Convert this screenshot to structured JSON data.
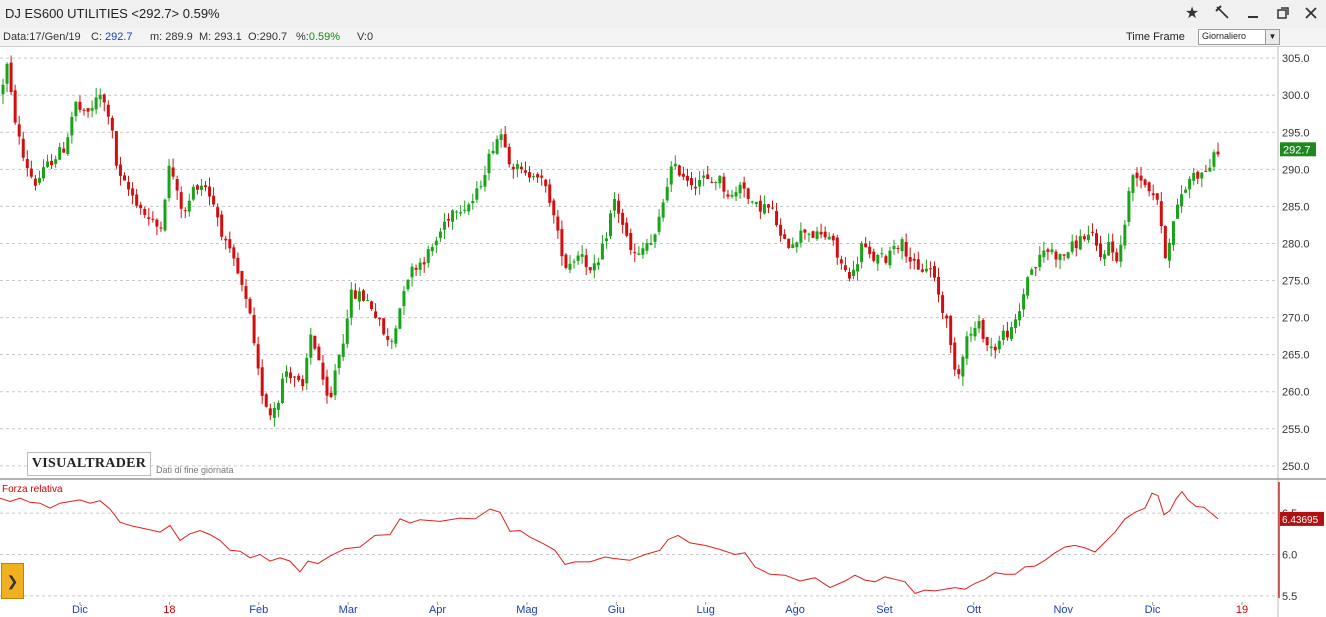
{
  "window": {
    "title": "DJ ES600 UTILITIES <292.7> 0.59%",
    "icons": [
      "star-icon",
      "pin-icon",
      "minimize-icon",
      "restore-icon",
      "close-icon"
    ]
  },
  "info_bar": {
    "date_label": "Data:",
    "date_value": "17/Gen/19",
    "close_label": "C:",
    "close_value": "292.7",
    "min_label": "m:",
    "min_value": "289.9",
    "max_label": "M:",
    "max_value": "293.1",
    "open_label": "O:",
    "open_value": "290.7",
    "pct_label": "%:",
    "pct_value": "0.59%",
    "vol_label": "V:",
    "vol_value": "0"
  },
  "timeframe": {
    "label": "Time Frame",
    "selected": "Giornaliero"
  },
  "logo_text": "VISUALTRADER",
  "eod_note": "Dati di fine giornata",
  "indicator": {
    "label": "Forza relativa",
    "last_value": "6.43695"
  },
  "colors": {
    "up": "#19a319",
    "down": "#d01010",
    "line": "#e02020",
    "price_tag": "#1e8a1e",
    "ind_tag": "#b01010"
  },
  "chart_data": {
    "type": "candlestick",
    "price_axis": {
      "ticks": [
        305.0,
        300.0,
        295.0,
        290.0,
        285.0,
        280.0,
        275.0,
        270.0,
        265.0,
        260.0,
        255.0,
        250.0
      ],
      "range": [
        248.5,
        306.5
      ]
    },
    "last_price": "292.7",
    "x_labels": [
      "Dic",
      "18",
      "Feb",
      "Mar",
      "Apr",
      "Mag",
      "Giu",
      "Lug",
      "Ago",
      "Set",
      "Ott",
      "Nov",
      "Dic",
      "19"
    ],
    "x_label_highlight": [
      "18",
      "19"
    ],
    "price_path": [
      [
        0,
        300
      ],
      [
        7,
        304
      ],
      [
        12,
        299
      ],
      [
        22,
        292
      ],
      [
        35,
        288
      ],
      [
        50,
        291
      ],
      [
        65,
        293
      ],
      [
        75,
        299
      ],
      [
        85,
        297
      ],
      [
        100,
        300
      ],
      [
        110,
        297
      ],
      [
        118,
        289
      ],
      [
        130,
        287
      ],
      [
        140,
        285
      ],
      [
        150,
        283
      ],
      [
        160,
        282
      ],
      [
        170,
        291
      ],
      [
        178,
        286
      ],
      [
        185,
        284
      ],
      [
        195,
        288
      ],
      [
        205,
        288
      ],
      [
        215,
        285
      ],
      [
        225,
        280
      ],
      [
        235,
        277
      ],
      [
        242,
        274
      ],
      [
        250,
        270
      ],
      [
        256,
        264
      ],
      [
        262,
        260
      ],
      [
        270,
        257
      ],
      [
        278,
        259
      ],
      [
        285,
        263
      ],
      [
        295,
        262
      ],
      [
        303,
        260
      ],
      [
        310,
        268
      ],
      [
        318,
        265
      ],
      [
        324,
        260
      ],
      [
        330,
        258
      ],
      [
        336,
        264
      ],
      [
        342,
        266
      ],
      [
        350,
        273
      ],
      [
        360,
        273
      ],
      [
        370,
        272
      ],
      [
        380,
        269
      ],
      [
        390,
        266
      ],
      [
        398,
        270
      ],
      [
        405,
        275
      ],
      [
        415,
        277
      ],
      [
        425,
        278
      ],
      [
        435,
        280
      ],
      [
        445,
        283
      ],
      [
        455,
        285
      ],
      [
        465,
        285
      ],
      [
        475,
        286
      ],
      [
        485,
        290
      ],
      [
        495,
        294
      ],
      [
        503,
        295
      ],
      [
        510,
        291
      ],
      [
        518,
        290
      ],
      [
        526,
        289
      ],
      [
        535,
        290
      ],
      [
        543,
        288
      ],
      [
        550,
        286
      ],
      [
        558,
        281
      ],
      [
        566,
        277
      ],
      [
        574,
        278
      ],
      [
        582,
        279
      ],
      [
        590,
        276
      ],
      [
        598,
        277
      ],
      [
        606,
        281
      ],
      [
        614,
        286
      ],
      [
        622,
        283
      ],
      [
        630,
        279
      ],
      [
        638,
        278
      ],
      [
        646,
        280
      ],
      [
        654,
        280
      ],
      [
        662,
        285
      ],
      [
        670,
        290
      ],
      [
        678,
        290
      ],
      [
        686,
        289
      ],
      [
        694,
        288
      ],
      [
        702,
        289
      ],
      [
        710,
        288
      ],
      [
        718,
        289
      ],
      [
        726,
        287
      ],
      [
        734,
        286
      ],
      [
        742,
        289
      ],
      [
        750,
        285
      ],
      [
        758,
        285
      ],
      [
        766,
        285
      ],
      [
        774,
        284
      ],
      [
        782,
        280
      ],
      [
        790,
        280
      ],
      [
        798,
        281
      ],
      [
        806,
        282
      ],
      [
        814,
        281
      ],
      [
        822,
        281
      ],
      [
        830,
        281
      ],
      [
        838,
        278
      ],
      [
        846,
        276
      ],
      [
        854,
        276
      ],
      [
        862,
        280
      ],
      [
        870,
        278
      ],
      [
        878,
        278
      ],
      [
        886,
        278
      ],
      [
        894,
        280
      ],
      [
        902,
        280
      ],
      [
        910,
        278
      ],
      [
        918,
        276
      ],
      [
        926,
        277
      ],
      [
        934,
        276
      ],
      [
        940,
        272
      ],
      [
        946,
        270
      ],
      [
        952,
        265
      ],
      [
        958,
        262
      ],
      [
        965,
        267
      ],
      [
        972,
        268
      ],
      [
        980,
        269
      ],
      [
        988,
        266
      ],
      [
        996,
        266
      ],
      [
        1004,
        268
      ],
      [
        1012,
        268
      ],
      [
        1020,
        271
      ],
      [
        1028,
        276
      ],
      [
        1036,
        277
      ],
      [
        1044,
        279
      ],
      [
        1052,
        279
      ],
      [
        1060,
        278
      ],
      [
        1068,
        279
      ],
      [
        1076,
        280
      ],
      [
        1084,
        281
      ],
      [
        1092,
        281
      ],
      [
        1100,
        278
      ],
      [
        1108,
        280
      ],
      [
        1116,
        278
      ],
      [
        1122,
        280
      ],
      [
        1128,
        286
      ],
      [
        1134,
        290
      ],
      [
        1140,
        289
      ],
      [
        1146,
        288
      ],
      [
        1152,
        287
      ],
      [
        1158,
        286
      ],
      [
        1164,
        278
      ],
      [
        1170,
        281
      ],
      [
        1176,
        284
      ],
      [
        1182,
        287
      ],
      [
        1188,
        288
      ],
      [
        1194,
        290
      ],
      [
        1200,
        289
      ],
      [
        1206,
        290
      ],
      [
        1212,
        291
      ],
      [
        1218,
        292.7
      ]
    ],
    "indicator_axis": {
      "ticks": [
        6.5,
        6.0,
        5.5
      ],
      "range": [
        5.45,
        6.9
      ]
    },
    "indicator_path": [
      [
        0,
        6.68
      ],
      [
        10,
        6.64
      ],
      [
        20,
        6.68
      ],
      [
        30,
        6.63
      ],
      [
        40,
        6.62
      ],
      [
        50,
        6.56
      ],
      [
        60,
        6.62
      ],
      [
        70,
        6.64
      ],
      [
        80,
        6.66
      ],
      [
        90,
        6.62
      ],
      [
        100,
        6.65
      ],
      [
        110,
        6.55
      ],
      [
        120,
        6.39
      ],
      [
        130,
        6.35
      ],
      [
        145,
        6.31
      ],
      [
        160,
        6.27
      ],
      [
        170,
        6.35
      ],
      [
        180,
        6.17
      ],
      [
        190,
        6.25
      ],
      [
        200,
        6.29
      ],
      [
        210,
        6.24
      ],
      [
        220,
        6.17
      ],
      [
        230,
        6.05
      ],
      [
        240,
        6.04
      ],
      [
        250,
        5.96
      ],
      [
        260,
        6.0
      ],
      [
        270,
        5.92
      ],
      [
        280,
        5.96
      ],
      [
        290,
        5.92
      ],
      [
        300,
        5.79
      ],
      [
        308,
        5.92
      ],
      [
        318,
        5.89
      ],
      [
        330,
        5.98
      ],
      [
        345,
        6.07
      ],
      [
        360,
        6.09
      ],
      [
        375,
        6.23
      ],
      [
        390,
        6.24
      ],
      [
        400,
        6.43
      ],
      [
        410,
        6.38
      ],
      [
        420,
        6.42
      ],
      [
        440,
        6.4
      ],
      [
        460,
        6.44
      ],
      [
        475,
        6.43
      ],
      [
        490,
        6.55
      ],
      [
        500,
        6.51
      ],
      [
        510,
        6.28
      ],
      [
        520,
        6.29
      ],
      [
        530,
        6.21
      ],
      [
        545,
        6.12
      ],
      [
        555,
        6.05
      ],
      [
        565,
        5.88
      ],
      [
        575,
        5.91
      ],
      [
        590,
        5.91
      ],
      [
        605,
        5.97
      ],
      [
        615,
        5.95
      ],
      [
        630,
        5.93
      ],
      [
        645,
        6.0
      ],
      [
        660,
        6.05
      ],
      [
        668,
        6.18
      ],
      [
        678,
        6.23
      ],
      [
        690,
        6.14
      ],
      [
        705,
        6.11
      ],
      [
        720,
        6.06
      ],
      [
        735,
        6.0
      ],
      [
        745,
        6.02
      ],
      [
        755,
        5.85
      ],
      [
        770,
        5.76
      ],
      [
        785,
        5.75
      ],
      [
        800,
        5.68
      ],
      [
        815,
        5.72
      ],
      [
        830,
        5.6
      ],
      [
        845,
        5.68
      ],
      [
        855,
        5.75
      ],
      [
        865,
        5.69
      ],
      [
        875,
        5.67
      ],
      [
        885,
        5.73
      ],
      [
        895,
        5.7
      ],
      [
        905,
        5.67
      ],
      [
        915,
        5.53
      ],
      [
        925,
        5.57
      ],
      [
        935,
        5.56
      ],
      [
        945,
        5.58
      ],
      [
        955,
        5.6
      ],
      [
        965,
        5.58
      ],
      [
        975,
        5.65
      ],
      [
        985,
        5.7
      ],
      [
        995,
        5.78
      ],
      [
        1005,
        5.76
      ],
      [
        1015,
        5.76
      ],
      [
        1025,
        5.85
      ],
      [
        1035,
        5.86
      ],
      [
        1045,
        5.93
      ],
      [
        1055,
        6.02
      ],
      [
        1065,
        6.09
      ],
      [
        1075,
        6.11
      ],
      [
        1085,
        6.08
      ],
      [
        1095,
        6.03
      ],
      [
        1105,
        6.15
      ],
      [
        1115,
        6.27
      ],
      [
        1125,
        6.43
      ],
      [
        1135,
        6.51
      ],
      [
        1145,
        6.56
      ],
      [
        1152,
        6.74
      ],
      [
        1158,
        6.71
      ],
      [
        1164,
        6.48
      ],
      [
        1170,
        6.53
      ],
      [
        1176,
        6.67
      ],
      [
        1182,
        6.76
      ],
      [
        1188,
        6.66
      ],
      [
        1196,
        6.58
      ],
      [
        1204,
        6.57
      ],
      [
        1212,
        6.49
      ],
      [
        1218,
        6.43
      ]
    ]
  }
}
